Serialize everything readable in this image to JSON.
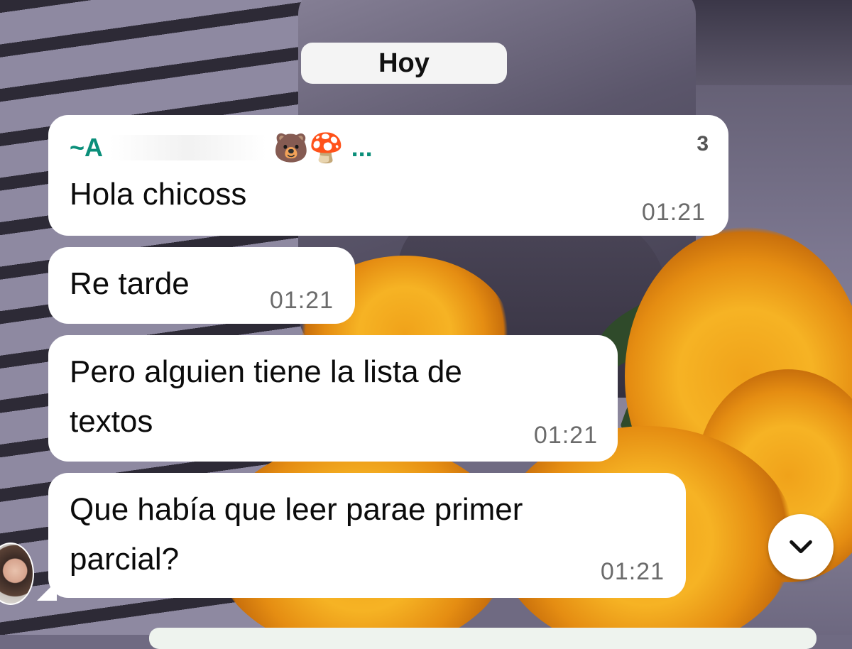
{
  "date_separator": "Hoy",
  "messages": [
    {
      "sender_prefix": "~A",
      "sender_emojis": "🐻🍄",
      "sender_ellipsis": "...",
      "sender_suffix": "3",
      "text": "Hola chicoss",
      "time": "01:21"
    },
    {
      "text": "Re tarde",
      "time": "01:21"
    },
    {
      "line1": "Pero alguien  tiene la lista de",
      "line2": "textos",
      "time": "01:21"
    },
    {
      "line1": "Que había que leer parae primer",
      "line2": "parcial?",
      "time": "01:21"
    }
  ],
  "scroll_button_icon": "chevron-down-icon",
  "colors": {
    "bubble": "#ffffff",
    "sender_name": "#0b8f7a",
    "timestamp": "#6b6b6b",
    "date_chip": "#f4f4f4"
  }
}
